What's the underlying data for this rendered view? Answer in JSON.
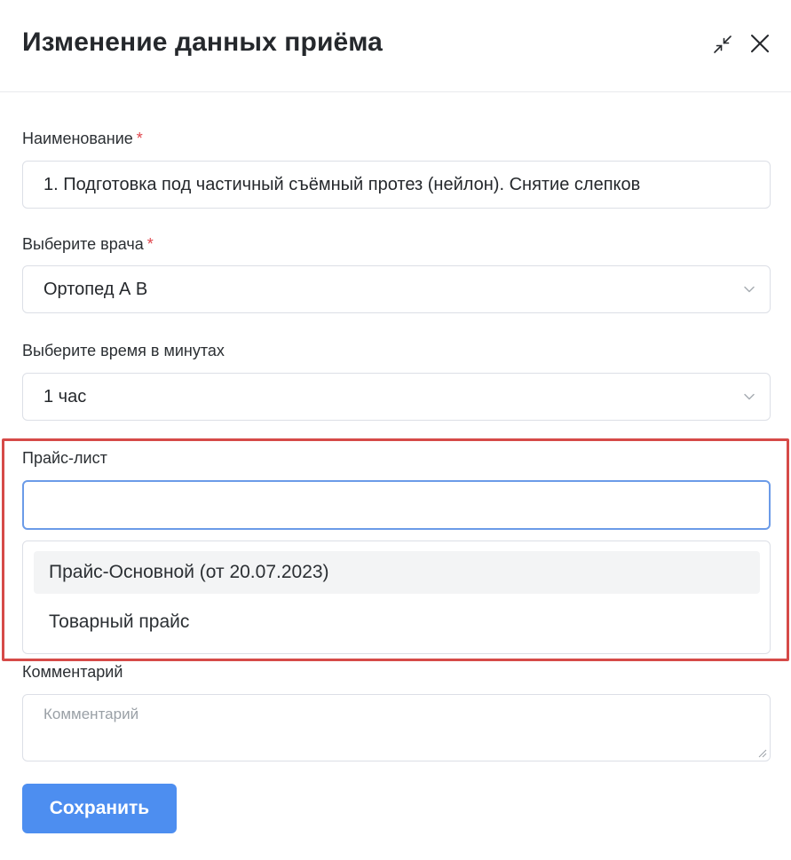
{
  "dialog": {
    "title": "Изменение данных приёма"
  },
  "form": {
    "name": {
      "label": "Наименование",
      "required_mark": "*",
      "value": "1. Подготовка под частичный съёмный протез (нейлон). Снятие слепков"
    },
    "doctor": {
      "label": "Выберите врача",
      "required_mark": "*",
      "value": "Ортопед А В"
    },
    "duration": {
      "label": "Выберите время в минутах",
      "value": "1 час"
    },
    "price_list": {
      "label": "Прайс-лист",
      "value": "",
      "options": [
        "Прайс-Основной (от 20.07.2023)",
        "Товарный прайс"
      ]
    },
    "comment": {
      "label": "Комментарий",
      "placeholder": "Комментарий"
    },
    "save_label": "Сохранить"
  },
  "colors": {
    "primary": "#4d8ef0",
    "required": "#e0454c",
    "highlight": "#d64a48",
    "focus_border": "#6b9be8"
  },
  "icons": {
    "collapse": "collapse-arrows-icon",
    "close": "close-icon",
    "chevron": "chevron-down-icon"
  }
}
